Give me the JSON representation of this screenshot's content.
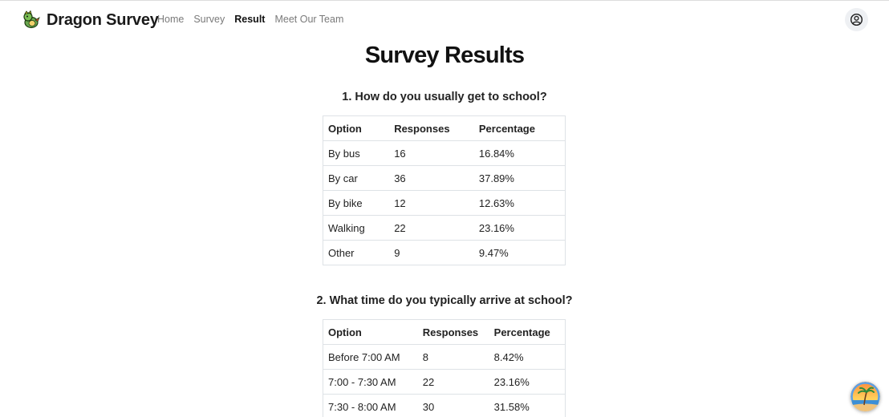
{
  "brand": {
    "name": "Dragon Survey",
    "icon": "dragon-logo-icon"
  },
  "nav": {
    "items": [
      {
        "label": "Home",
        "active": false
      },
      {
        "label": "Survey",
        "active": false
      },
      {
        "label": "Result",
        "active": true
      },
      {
        "label": "Meet Our Team",
        "active": false
      }
    ]
  },
  "user_icon": "user-circle-icon",
  "page_title": "Survey Results",
  "questions": [
    {
      "title": "1. How do you usually get to school?",
      "headers": [
        "Option",
        "Responses",
        "Percentage"
      ],
      "rows": [
        [
          "By bus",
          "16",
          "16.84%"
        ],
        [
          "By car",
          "36",
          "37.89%"
        ],
        [
          "By bike",
          "12",
          "12.63%"
        ],
        [
          "Walking",
          "22",
          "23.16%"
        ],
        [
          "Other",
          "9",
          "9.47%"
        ]
      ]
    },
    {
      "title": "2. What time do you typically arrive at school?",
      "headers": [
        "Option",
        "Responses",
        "Percentage"
      ],
      "rows": [
        [
          "Before 7:00 AM",
          "8",
          "8.42%"
        ],
        [
          "7:00 - 7:30 AM",
          "22",
          "23.16%"
        ],
        [
          "7:30 - 8:00 AM",
          "30",
          "31.58%"
        ]
      ]
    }
  ],
  "colors": {
    "active_nav": "#111111",
    "muted_nav": "#7a7a7a",
    "border": "#dee2e6"
  }
}
